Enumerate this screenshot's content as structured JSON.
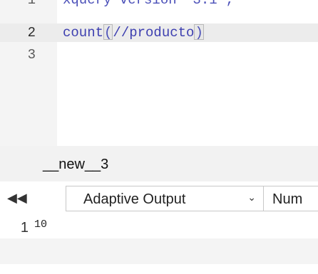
{
  "editor": {
    "lines": [
      {
        "number": "1",
        "text": "xquery version \"3.1\";"
      },
      {
        "number": "2",
        "prefix": "count",
        "open": "(",
        "arg": "//producto",
        "close": ")"
      },
      {
        "number": "3",
        "text": ""
      }
    ]
  },
  "result_tab": {
    "title": "__new__3"
  },
  "toolbar": {
    "collapse_icon": "double-chevron-left-icon",
    "output_select": {
      "selected": "Adaptive Output"
    },
    "num_button_label": "Num"
  },
  "output": {
    "lines": [
      {
        "number": "1",
        "value": "10"
      }
    ]
  }
}
